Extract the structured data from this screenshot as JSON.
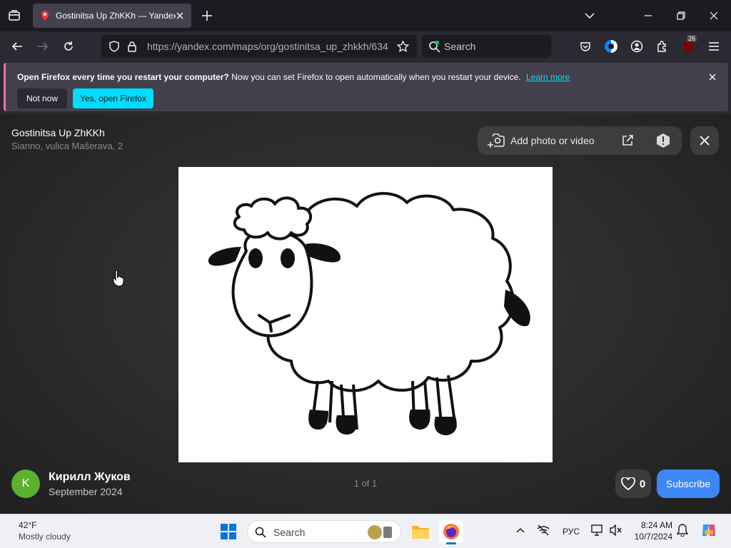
{
  "browser": {
    "tab_title": "Gostinitsa Up ZhKKh — Yandex Maps",
    "url": "https://yandex.com/maps/org/gostinitsa_up_zhkkh/634",
    "search_placeholder": "Search",
    "extension_badge": "26"
  },
  "notification": {
    "bold_text": "Open Firefox every time you restart your computer?",
    "text": "Now you can set Firefox to open automatically when you restart your device.",
    "link": "Learn more",
    "not_now": "Not now",
    "open": "Yes, open Firefox"
  },
  "viewer": {
    "org_name": "Gostinitsa Up ZhKKh",
    "org_address": "Sianno, vulica Mašerava, 2",
    "add_photo": "Add photo or video",
    "author_initial": "K",
    "author_name": "Кирилл Жуков",
    "author_date": "September 2024",
    "counter": "1 of 1",
    "likes": "0",
    "subscribe": "Subscribe",
    "avatar_color": "#5bb02e",
    "subscribe_color": "#3d86f5"
  },
  "taskbar": {
    "temp": "42°F",
    "weather": "Mostly cloudy",
    "search_label": "Search",
    "lang": "РУС",
    "time": "8:24 AM",
    "date": "10/7/2024"
  }
}
